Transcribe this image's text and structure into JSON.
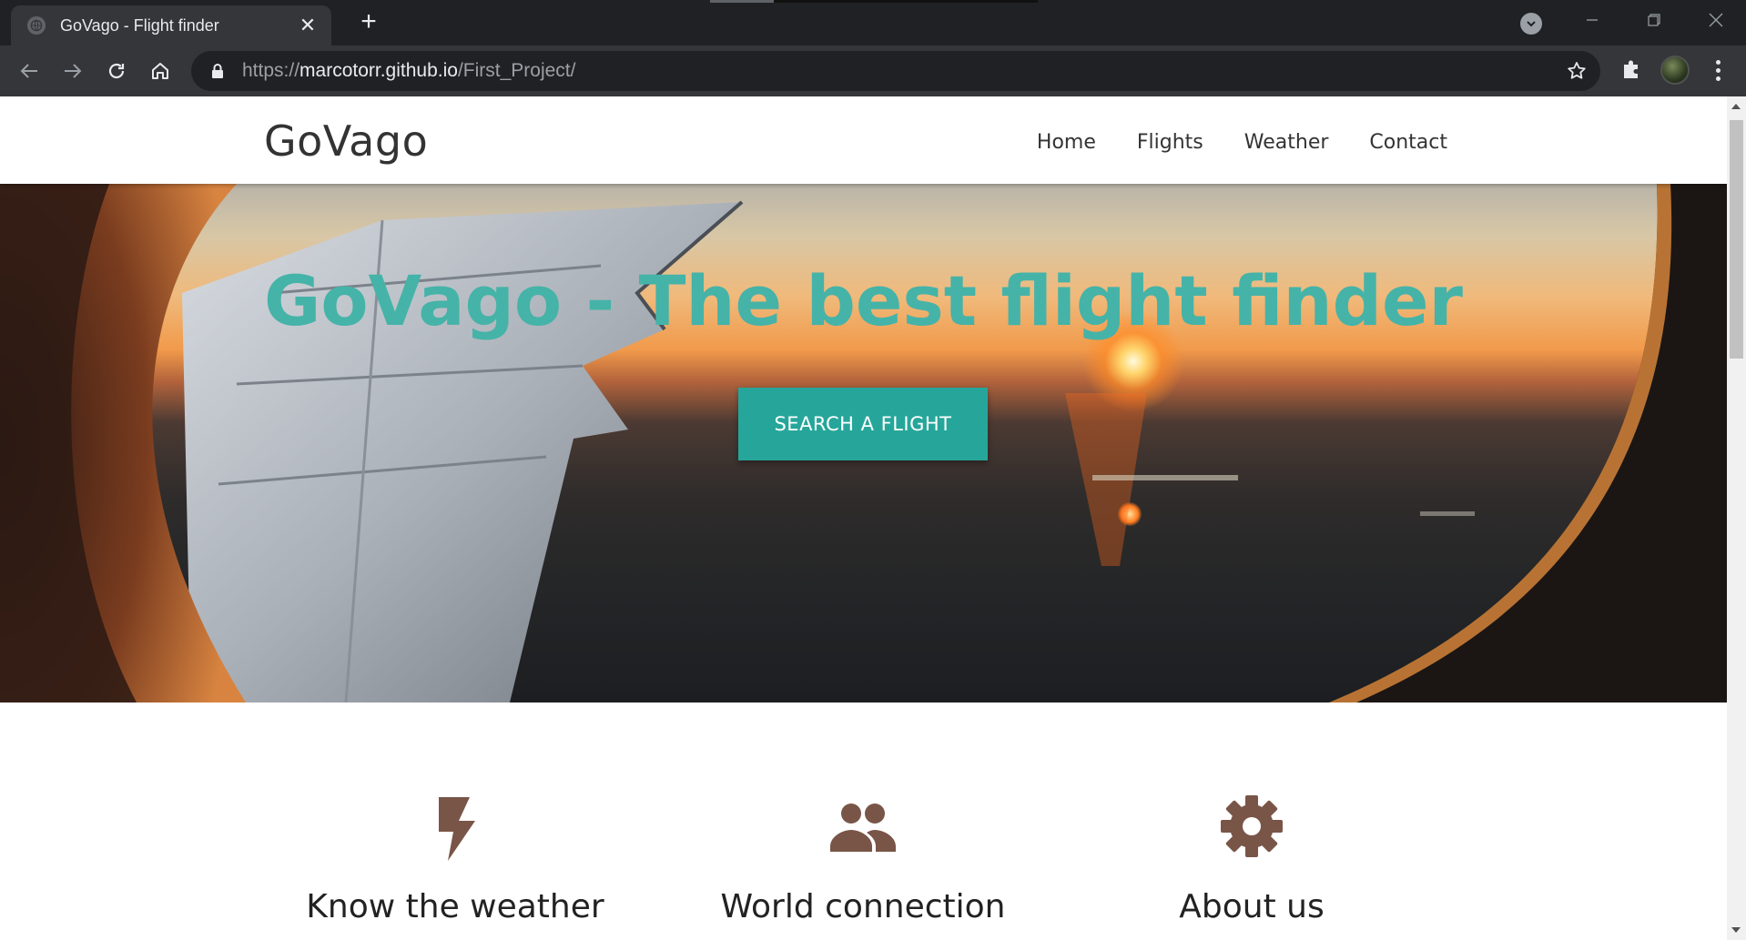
{
  "browser": {
    "tab": {
      "title": "GoVago - Flight finder",
      "close_glyph": "✕",
      "favicon": "globe-icon"
    },
    "new_tab_glyph": "+",
    "url": {
      "scheme": "https://",
      "host": "marcotorr.github.io",
      "path": "/First_Project/"
    }
  },
  "site": {
    "brand": "GoVago",
    "nav": [
      {
        "label": "Home"
      },
      {
        "label": "Flights"
      },
      {
        "label": "Weather"
      },
      {
        "label": "Contact"
      }
    ]
  },
  "hero": {
    "title": "GoVago - The best flight finder",
    "cta_label": "SEARCH A FLIGHT"
  },
  "features": [
    {
      "title": "Know the weather",
      "icon": "flash-icon"
    },
    {
      "title": "World connection",
      "icon": "people-icon"
    },
    {
      "title": "About us",
      "icon": "gear-icon"
    }
  ],
  "colors": {
    "accent": "#26a69a",
    "hero_title": "#45b3a8",
    "feature_icon": "#795548"
  }
}
